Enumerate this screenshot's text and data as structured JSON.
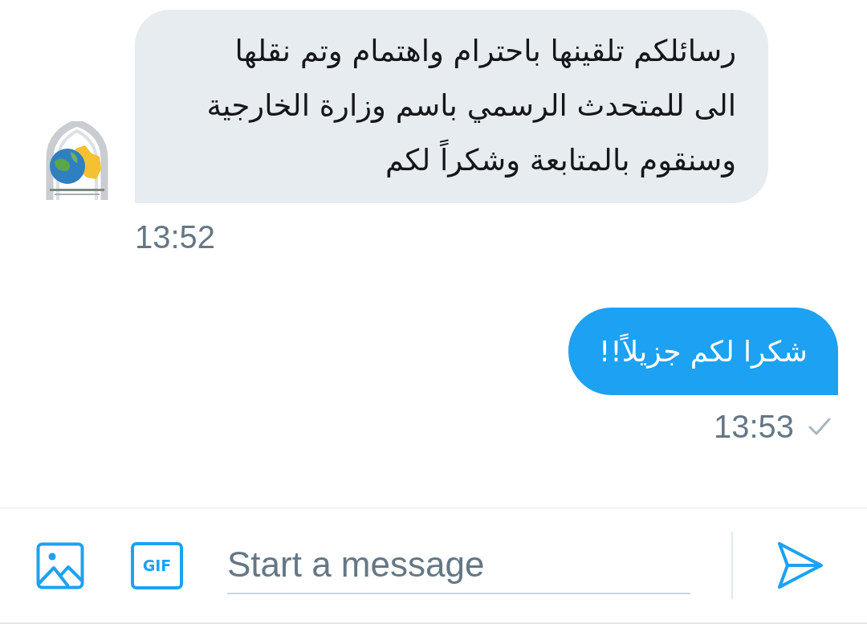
{
  "messages": [
    {
      "kind": "received",
      "lines": [
        "رسائلكم تلقينها باحترام واهتمام وتم نقلها",
        "الى للمتحدث الرسمي باسم وزارة الخارجية",
        "وسنقوم بالمتابعة وشكراً لكم"
      ],
      "time": "13:52"
    },
    {
      "kind": "sent",
      "lines": [
        "شكرا لكم جزيلاً!!"
      ],
      "time": "13:53",
      "delivered": true
    }
  ],
  "composer": {
    "gif_label": "GIF",
    "placeholder": "Start a message"
  }
}
